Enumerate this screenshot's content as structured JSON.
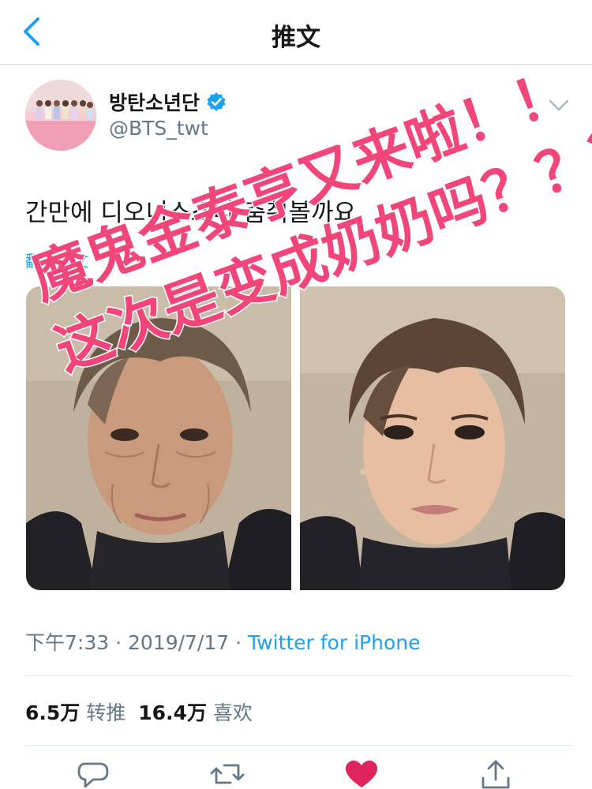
{
  "nav": {
    "title": "推文",
    "back_icon": "chevron-left-icon"
  },
  "tweet": {
    "display_name": "방탄소년단",
    "handle": "@BTS_twt",
    "verified_icon": "verified-badge-icon",
    "menu_icon": "chevron-down-icon",
    "text": "간만에 디오니소스나 춤춰볼까요",
    "translate_label": "翻译推文",
    "time": "下午7:33",
    "sep1": " · ",
    "date": "2019/7/17",
    "sep2": " · ",
    "source": "Twitter for iPhone",
    "retweets_count": "6.5万",
    "retweets_label": "转推",
    "likes_count": "16.4万",
    "likes_label": "喜欢"
  },
  "actions": {
    "reply_icon": "reply-icon",
    "retweet_icon": "retweet-icon",
    "like_icon": "heart-icon",
    "share_icon": "share-icon"
  },
  "overlay": {
    "line1": "魔鬼金泰亨又来啦！！",
    "line2": "这次是变成奶奶吗？？？",
    "color": "#f2467a"
  },
  "colors": {
    "accent": "#1da1f2",
    "like": "#e0245e",
    "text": "#14171a",
    "secondary": "#657786"
  }
}
